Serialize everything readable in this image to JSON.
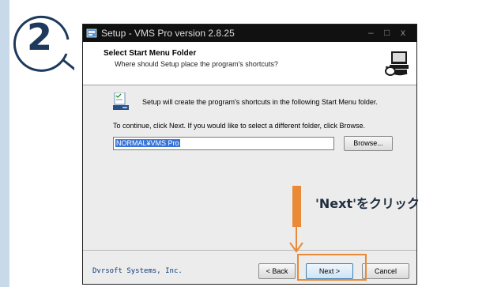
{
  "step": {
    "number": "2"
  },
  "window": {
    "title": "Setup - VMS Pro version 2.8.25",
    "controls": {
      "minimize": "–",
      "maximize": "□",
      "close": "x"
    }
  },
  "header": {
    "title": "Select Start Menu Folder",
    "subtitle": "Where should Setup place the program's shortcuts?"
  },
  "body": {
    "line1": "Setup will create the program's shortcuts in the following Start Menu folder.",
    "line2": "To continue, click Next. If you would like to select a different folder, click Browse.",
    "folder_value": "NORMAL¥VMS Pro",
    "browse_label": "Browse..."
  },
  "footer": {
    "brand": "Dvrsoft Systems, Inc.",
    "back_label": "< Back",
    "next_label": "Next >",
    "cancel_label": "Cancel"
  },
  "annotation": {
    "text": "'Next'をクリック",
    "accent_color": "#ea8a36"
  },
  "colors": {
    "titlebar": "#111111",
    "badge": "#1d3a5c",
    "strip": "#c8d9ea"
  }
}
